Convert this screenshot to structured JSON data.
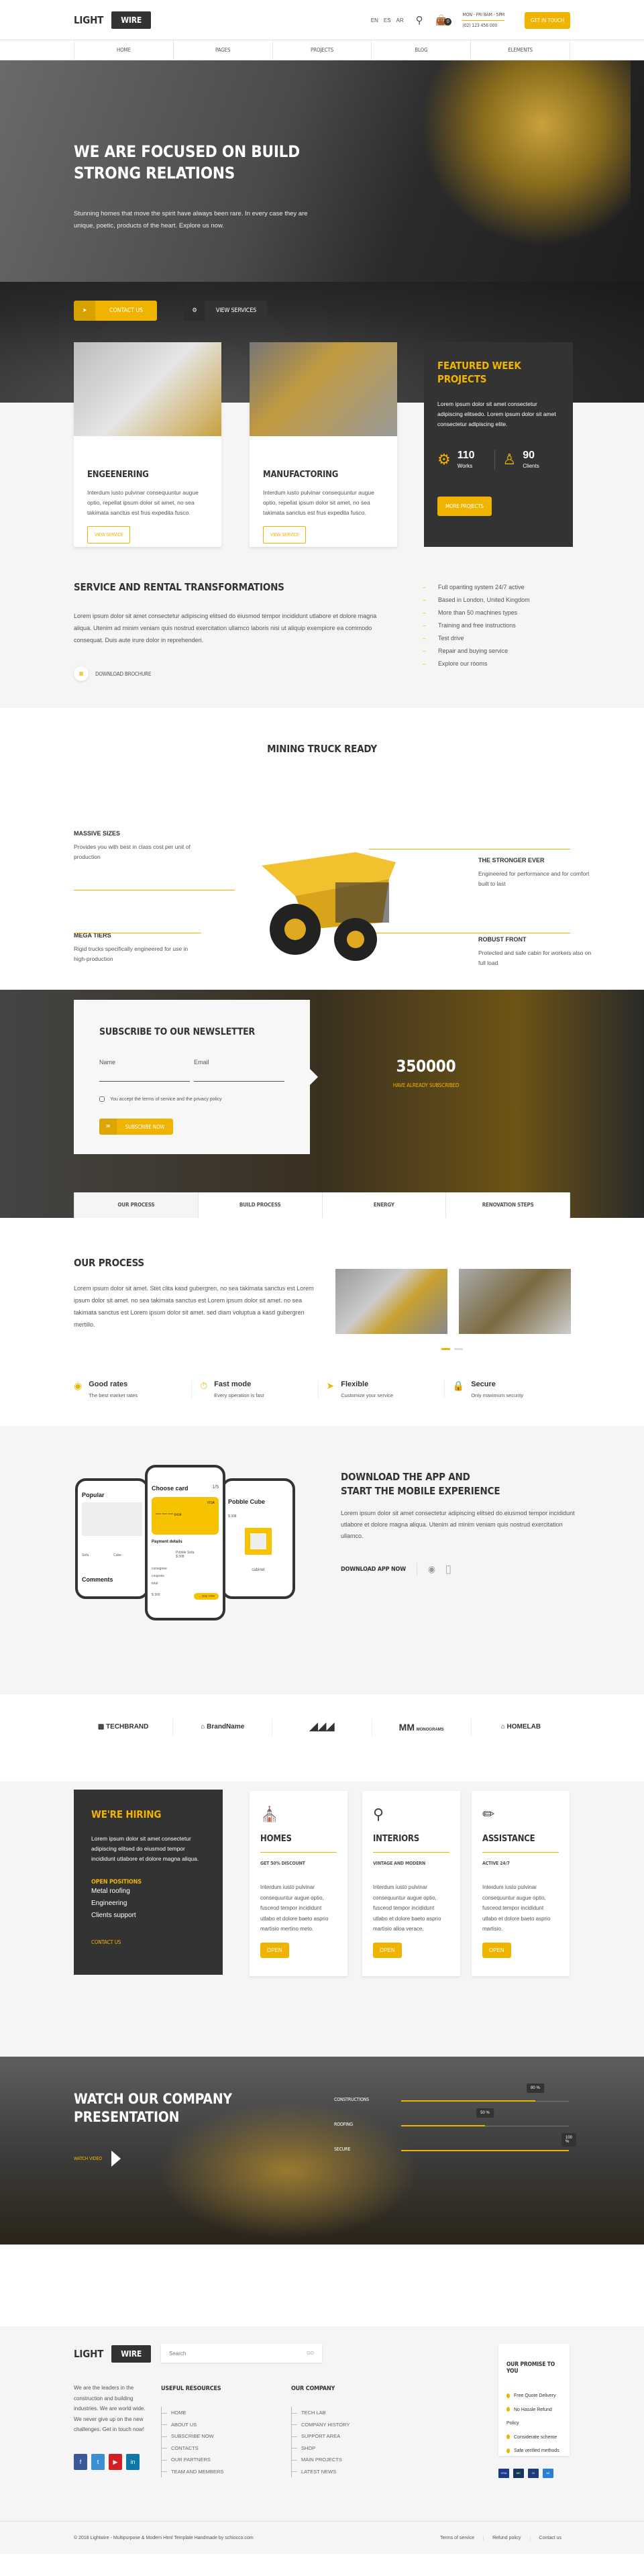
{
  "colors": {
    "accent": "#f0b400",
    "dark": "#333333",
    "light_bg": "#f5f5f5"
  },
  "header": {
    "logo_left": "LIGHT",
    "logo_right": "WIRE",
    "languages": [
      "EN",
      "ES",
      "AR"
    ],
    "search_icon": "search-icon",
    "cart_icon": "bag-icon",
    "cart_count": "0",
    "hours": "MON - FRI 8AM - 5PM",
    "phone": "(02) 123 456 000",
    "cta": "GET IN TOUCH"
  },
  "nav": [
    "HOME",
    "PAGES",
    "PROJECTS",
    "BLOG",
    "ELEMENTS"
  ],
  "hero": {
    "title": "WE ARE FOCUSED ON BUILD STRONG RELATIONS",
    "text": "Stunning homes that move the spirit have always been rare. In every case they are unique, poetic, products of the heart. Explore us now.",
    "btn_contact": "CONTACT US",
    "btn_services": "VIEW SERVICES"
  },
  "cards": [
    {
      "title": "ENGEENERING",
      "text": "Interdum iusto pulvinar consequuntur augue optio, repellat ipsum dolor sit amet, no sea takimata sanctus est frus expedita fusco.",
      "button": "VIEW SERVICE"
    },
    {
      "title": "MANUFACTORING",
      "text": "Interdum iusto pulvinar consequuntur augue optio, repellat ipsum dolor sit amet, no sea takimata sanctus est frus expedita fusco.",
      "button": "VIEW SERVICE"
    }
  ],
  "featured": {
    "title": "FEATURED WEEK PROJECTS",
    "text": "Lorem ipsum dolor sit amet consectetur adipiscing elitsedo. Lorem ipsum dolor sit amet consectetur adipiscing elite.",
    "stats": [
      {
        "value": "110",
        "label": "Works"
      },
      {
        "value": "90",
        "label": "Clients"
      }
    ],
    "button": "MORE PROJECTS"
  },
  "service": {
    "title": "SERVICE AND RENTAL TRANSFORMATIONS",
    "text": "Lorem ipsum dolor sit amet consectetur adipiscing elitsed do eiusmod tempor incididunt utlabore et dolore magna aliqua. Utenim ad minim veniam quis nostrud exercitation ullamco laboris nisi ut aliquip exempiore ea commodo consequat. Duis aute irure dolor in reprehenderi.",
    "download": "DOWNLOAD BROCHURE",
    "list": [
      "Full opariting system 24/7 active",
      "Based in London, United Kingdom",
      "More than 50 machines types",
      "Training and free instructions",
      "Test drive",
      "Repair and buying service",
      "Explore our rooms"
    ]
  },
  "truck": {
    "title": "MINING TRUCK READY",
    "features": [
      {
        "title": "MASSIVE SIZES",
        "text": "Provides you with best in class cost per unit of production"
      },
      {
        "title": "MEGA TIERS",
        "text": "Rigid trucks specifically engineered for use in high-production"
      },
      {
        "title": "THE STRONGER EVER",
        "text": "Engineered for performance and for comfort built to last"
      },
      {
        "title": "ROBUST FRONT",
        "text": "Protected and safe cabin for workers also on full load"
      }
    ]
  },
  "newsletter": {
    "title": "SUBSCRIBE TO OUR NEWSLETTER",
    "name_label": "Name",
    "email_label": "Email",
    "terms": "You accept the terms of service and the privacy policy",
    "button": "SUBSCRIBE NOW",
    "count": "350000",
    "count_label": "HAVE ALREADY SUBSCRIBED"
  },
  "tabs": [
    "OUR PROCESS",
    "BUILD PROCESS",
    "ENERGY",
    "RENOVATION STEPS"
  ],
  "process": {
    "title": "OUR PROCESS",
    "text": "Lorem ipsum dolor sit amet. Stet clita kasd gubergren, no sea takimata sanctus est Lorem ipsum dolor sit amet. no sea takimata sanctus est Lorem ipsum dolor sit amet. no sea takimata sanctus est Lorem ipsum dolor sit amet. sed diam voluptua a kasd gubergren mertillo.",
    "features": [
      {
        "title": "Good rates",
        "text": "The best market rates",
        "icon": "coins-icon"
      },
      {
        "title": "Fast mode",
        "text": "Every operation is fast",
        "icon": "stopwatch-icon"
      },
      {
        "title": "Flexible",
        "text": "Customize your service",
        "icon": "paper-plane-icon"
      },
      {
        "title": "Secure",
        "text": "Only maximum security",
        "icon": "lock-icon"
      }
    ]
  },
  "app": {
    "title1": "DOWNLOAD THE APP AND",
    "title2": "START THE MOBILE EXPERIENCE",
    "text": "Lorem ipsum dolor sit amet consectetur adipiscing elitsed do eiusmod tempor incididunt utlabore et dolore magna aliqua. Utenim ad minim veniam quis nostrud exercitation ullamco.",
    "download": "DOWNLOAD APP NOW",
    "phone1": {
      "title": "Popular",
      "items": [
        "Sofa",
        "Cube"
      ],
      "comments": "Comments"
    },
    "phone2": {
      "title": "Choose card",
      "page": "1/5",
      "card_brand": "VISA",
      "card_number": "**** **** **** 6434",
      "payment": "Payment details",
      "product": "Pobble Sofa",
      "price": "$ 308",
      "rows": [
        "consignee",
        "coupons",
        "total"
      ],
      "total": "$ 300",
      "pay": "→ pay now"
    },
    "phone3": {
      "title": "Pobble Cube",
      "price": "$ 308",
      "label": "cabinet"
    }
  },
  "logos": [
    "TECHBRAND",
    "BrandName",
    "",
    "MONOGRAMS",
    "HOMELAB"
  ],
  "hiring": {
    "title": "WE'RE HIRING",
    "text": "Lorem ipsum dolor sit amet consectetur adipiscing elitsed do eiusmod tempor incididunt utlabore et dolore magna aliqua.",
    "positions_title": "OPEN POSITIONS",
    "positions": [
      "Metal roofing",
      "Engineering",
      "Clients support"
    ],
    "contact": "CONTACT US"
  },
  "services": [
    {
      "title": "HOMES",
      "subtitle": "GET 50% DISCOUNT",
      "text": "Interdum iusto pulvinar consequuntur augue optio, fusceod tempor incididunt utlabo et dolore baeto asprio martisio mertino meto.",
      "button": "OPEN",
      "icon": "crane-icon"
    },
    {
      "title": "INTERIORS",
      "subtitle": "VINTAGE AND MODERN",
      "text": "Interdum iusto pulvinar consequuntur augue optio, fusceod tempor incididunt utlabo et dolore baeto asprio martisio alloa verace.",
      "button": "OPEN",
      "icon": "lamp-icon"
    },
    {
      "title": "ASSISTANCE",
      "subtitle": "ACTIVE 24/7",
      "text": "Interdum iusto pulvinar consequuntur augue optio, fusceod tempor incididunt utlabo et dolore baeto asprio martisio.",
      "button": "OPEN",
      "icon": "screwdriver-icon"
    }
  ],
  "video": {
    "title": "WATCH OUR COMPANY PRESENTATION",
    "watch": "WATCH VIDEO",
    "bars": [
      {
        "label": "CONSTRUCTIONS",
        "value": 80,
        "text": "80 %"
      },
      {
        "label": "ROOFING",
        "value": 50,
        "text": "50 %"
      },
      {
        "label": "SECURE",
        "value": 100,
        "text": "100 %"
      }
    ]
  },
  "footer": {
    "about": "We are the leaders in the construction and building industries. We are world wide. We never give up on the new challenges. Get in touch now!",
    "search_placeholder": "Search",
    "search_go": "GO",
    "resources_title": "USEFUL RESOURCES",
    "resources": [
      "HOME",
      "ABOUT US",
      "SUBSCRIBE NOW",
      "CONTACTS",
      "OUR PARTNERS",
      "TEAM AND MEMBERS"
    ],
    "company_title": "OUR COMPANY",
    "company": [
      "TECH LAB",
      "COMPANY HISTORY",
      "SUPPORT AREA",
      "SHOP",
      "MAIN PROJECTS",
      "LATEST NEWS"
    ],
    "promise_title": "OUR PROMISE TO YOU",
    "promise": [
      "Free Quote Delivery",
      "No Hassle Refund Policy",
      "Considerate scheme",
      "Safe verified methods"
    ],
    "payments": [
      "VISA",
      "MasterCard",
      "Maestro",
      "American Express"
    ],
    "copyright": "© 2018 Lightwire - Multipurpose & Modern Html Template Handmade by schiocco.com",
    "links": [
      "Terms of service",
      "Refund policy",
      "Contact us"
    ]
  }
}
